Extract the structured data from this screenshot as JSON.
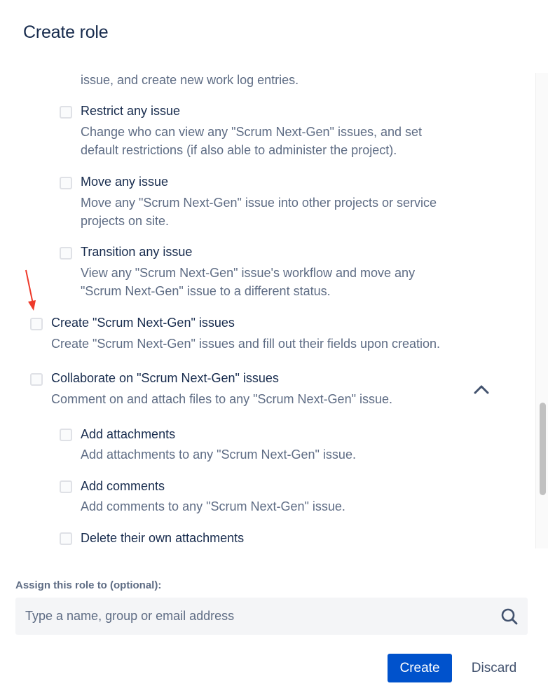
{
  "dialog": {
    "title": "Create role"
  },
  "permissions": {
    "work_on_issues_tail": "issue, and create new work log entries.",
    "restrict": {
      "title": "Restrict any issue",
      "desc_line1": "Change who can view any \"Scrum Next-Gen\" issues, and set",
      "desc_line2": "default restrictions (if also able to administer the project)."
    },
    "move": {
      "title": "Move any issue",
      "desc_line1": "Move any \"Scrum Next-Gen\" issue into other projects or service",
      "desc_line2": "projects on site."
    },
    "transition": {
      "title": "Transition any issue",
      "desc_line1": "View any \"Scrum Next-Gen\" issue's workflow and move any",
      "desc_line2": "\"Scrum Next-Gen\" issue to a different status."
    },
    "create": {
      "title": "Create \"Scrum Next-Gen\" issues",
      "desc": "Create \"Scrum Next-Gen\" issues and fill out their fields upon creation."
    },
    "collaborate": {
      "title": "Collaborate on \"Scrum Next-Gen\" issues",
      "desc": "Comment on and attach files to any \"Scrum Next-Gen\" issue."
    },
    "add_attachments": {
      "title": "Add attachments",
      "desc": "Add attachments to any \"Scrum Next-Gen\" issue."
    },
    "add_comments": {
      "title": "Add comments",
      "desc": "Add comments to any \"Scrum Next-Gen\" issue."
    },
    "delete_own_attachments": {
      "title": "Delete their own attachments"
    }
  },
  "assign": {
    "label": "Assign this role to (optional):",
    "placeholder": "Type a name, group or email address",
    "value": ""
  },
  "actions": {
    "create_label": "Create",
    "discard_label": "Discard"
  },
  "colors": {
    "primary": "#0052cc",
    "heading": "#172b4d",
    "subtle": "#5e6c84",
    "annotation_arrow": "#ee3a2b"
  },
  "icons": {
    "chevron": "chevron-up-icon",
    "search": "search-icon",
    "annotation": "red-arrow-icon"
  }
}
